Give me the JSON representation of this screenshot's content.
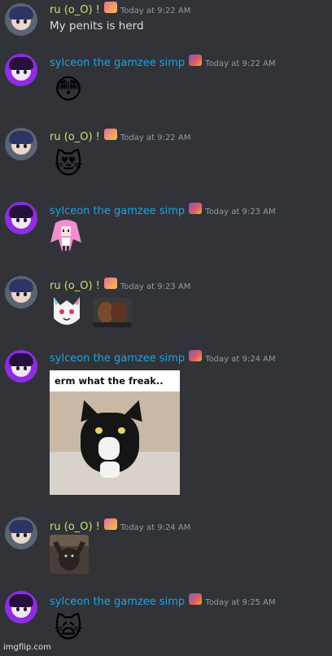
{
  "users": {
    "ru": {
      "name": "ru (o_O) !",
      "name_color": "#c7e36c",
      "badge": "flower-badge-icon"
    },
    "sylceon": {
      "name": "sylceon the gamzee simp",
      "name_color": "#21a2e2",
      "badge": "pixel-badge-icon"
    }
  },
  "messages": [
    {
      "author": "ru (o_O) !",
      "time": "Today at 9:22 AM",
      "text": "My penits is herd"
    },
    {
      "author": "sylceon the gamzee simp",
      "time": "Today at 9:22 AM",
      "emoji": "😳"
    },
    {
      "author": "ru (o_O) !",
      "time": "Today at 9:22 AM",
      "emoji": "😻"
    },
    {
      "author": "sylceon the gamzee simp",
      "time": "Today at 9:23 AM",
      "sticker": "pink-haired-character-sticker"
    },
    {
      "author": "ru (o_O) !",
      "time": "Today at 9:23 AM",
      "stickers": [
        "furry-character-sticker",
        "kiss-image-sticker"
      ]
    },
    {
      "author": "sylceon the gamzee simp",
      "time": "Today at 9:24 AM",
      "meme_caption": "erm what the freak.."
    },
    {
      "author": "ru (o_O) !",
      "time": "Today at 9:24 AM",
      "sticker": "cat-dance-gif"
    },
    {
      "author": "sylceon the gamzee simp",
      "time": "Today at 9:25 AM",
      "emoji": "🙀"
    }
  ],
  "watermark": "imgflip.com",
  "colors": {
    "background": "#313338",
    "text": "#dbdee1",
    "timestamp": "#949ba4"
  }
}
